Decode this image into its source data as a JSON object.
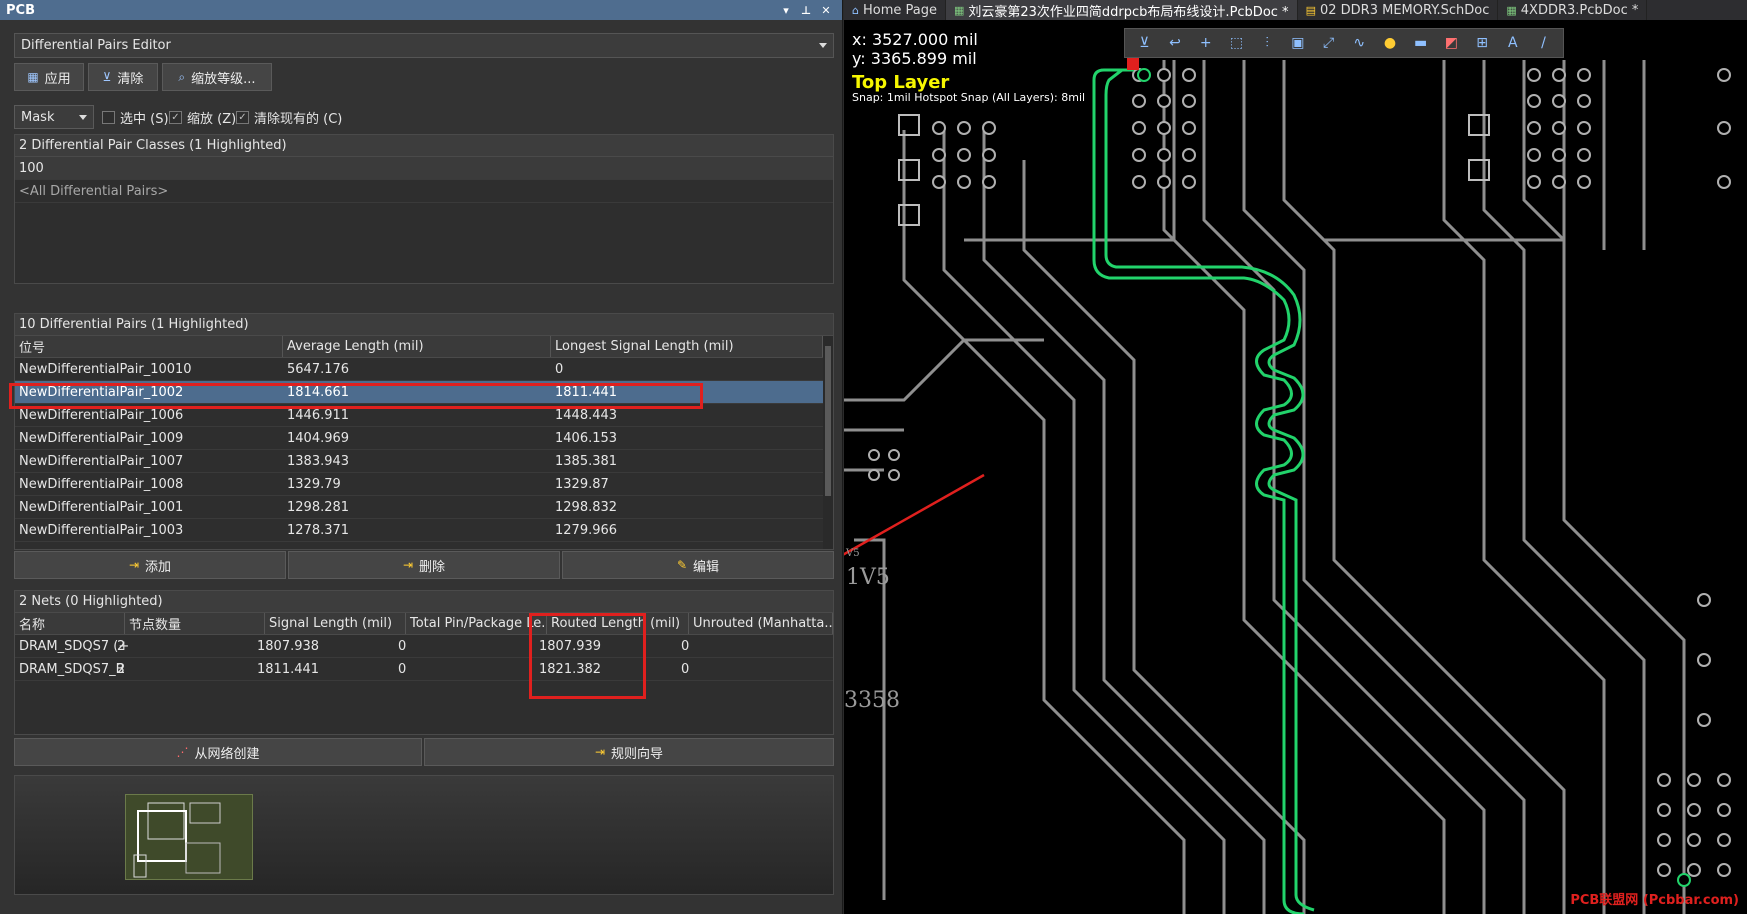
{
  "panel": {
    "title": "PCB",
    "controls": [
      "▾",
      "📌",
      "✕"
    ],
    "dropdown": "Differential Pairs Editor",
    "buttons": {
      "apply": "应用",
      "clear": "清除",
      "zoom": "缩放等级..."
    },
    "mask": "Mask",
    "checks": {
      "select": "选中 (S)",
      "zoom": "缩放 (Z)",
      "clear_existing": "清除现有的 (C)"
    }
  },
  "classes": {
    "header": "2 Differential Pair Classes (1 Highlighted)",
    "items": [
      "100",
      "<All Differential Pairs>"
    ]
  },
  "pairs": {
    "header": "10 Differential Pairs (1 Highlighted)",
    "columns": [
      "位号",
      "Average Length (mil)",
      "Longest Signal Length (mil)"
    ],
    "rows": [
      {
        "name": "NewDifferentialPair_10010",
        "avg": "5647.176",
        "longest": "0"
      },
      {
        "name": "NewDifferentialPair_1002",
        "avg": "1814.661",
        "longest": "1811.441"
      },
      {
        "name": "NewDifferentialPair_1006",
        "avg": "1446.911",
        "longest": "1448.443"
      },
      {
        "name": "NewDifferentialPair_1009",
        "avg": "1404.969",
        "longest": "1406.153"
      },
      {
        "name": "NewDifferentialPair_1007",
        "avg": "1383.943",
        "longest": "1385.381"
      },
      {
        "name": "NewDifferentialPair_1008",
        "avg": "1329.79",
        "longest": "1329.87"
      },
      {
        "name": "NewDifferentialPair_1001",
        "avg": "1298.281",
        "longest": "1298.832"
      },
      {
        "name": "NewDifferentialPair_1003",
        "avg": "1278.371",
        "longest": "1279.966"
      }
    ],
    "actions": {
      "add": "添加",
      "delete": "删除",
      "edit": "编辑"
    }
  },
  "nets": {
    "header": "2 Nets (0 Highlighted)",
    "columns": [
      "名称",
      "节点数量",
      "Signal Length (mil)",
      "Total Pin/Package Le...",
      "Routed Length (mil)",
      "Unrouted (Manhatta..."
    ],
    "rows": [
      {
        "name": "DRAM_SDQS7 (+",
        "nodes": "2",
        "signal": "1807.938",
        "pin": "0",
        "routed": "1807.939",
        "unrouted": "0"
      },
      {
        "name": "DRAM_SDQS7_B",
        "nodes": "2",
        "signal": "1811.441",
        "pin": "0",
        "routed": "1821.382",
        "unrouted": "0"
      }
    ],
    "actions": {
      "from_net": "从网络创建",
      "rule_wizard": "规则向导"
    }
  },
  "canvas": {
    "tabs": [
      {
        "label": "Home Page",
        "icon": "home-icon"
      },
      {
        "label": "刘云豪第23次作业四简ddrpcb布局布线设计.PcbDoc *",
        "icon": "pcb-doc-icon"
      },
      {
        "label": "02 DDR3 MEMORY.SchDoc",
        "icon": "sch-doc-icon"
      },
      {
        "label": "4XDDR3.PcbDoc *",
        "icon": "pcb-doc-icon"
      }
    ],
    "x": "x:  3527.000 mil",
    "y": "y:  3365.899 mil",
    "layer": "Top Layer",
    "snap": "Snap: 1mil Hotspot Snap (All Layers): 8mil",
    "labels": [
      "1V5",
      "3358",
      "V5"
    ],
    "watermark": "PCB联盟网 (Pcbbar.com)",
    "colors": {
      "trace_highlight": "#22d36b",
      "trace": "#9a9a9a",
      "layer_text": "#f6f600",
      "annotation": "#e0201e"
    }
  }
}
